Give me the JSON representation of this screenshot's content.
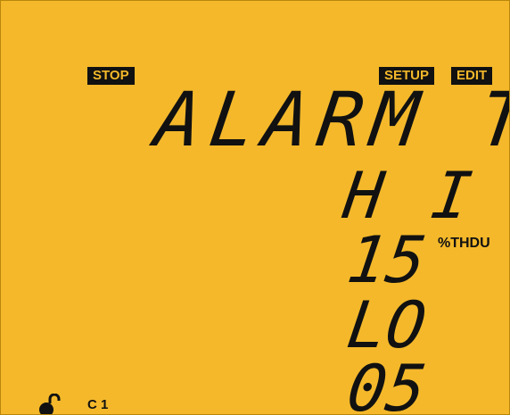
{
  "indicators": {
    "stop": "STOP",
    "setup": "SETUP",
    "edit": "EDIT"
  },
  "display": {
    "title": "ALARM TH",
    "hi_label": "H I",
    "hi_value": "15",
    "unit": "%THDU",
    "lo_label": "LO",
    "lo_value": "05"
  },
  "status": {
    "lock_icon": "unlocked-padlock-icon",
    "channel": "C 1"
  },
  "colors": {
    "lcd_background": "#f4b82a",
    "segment": "#111111"
  }
}
